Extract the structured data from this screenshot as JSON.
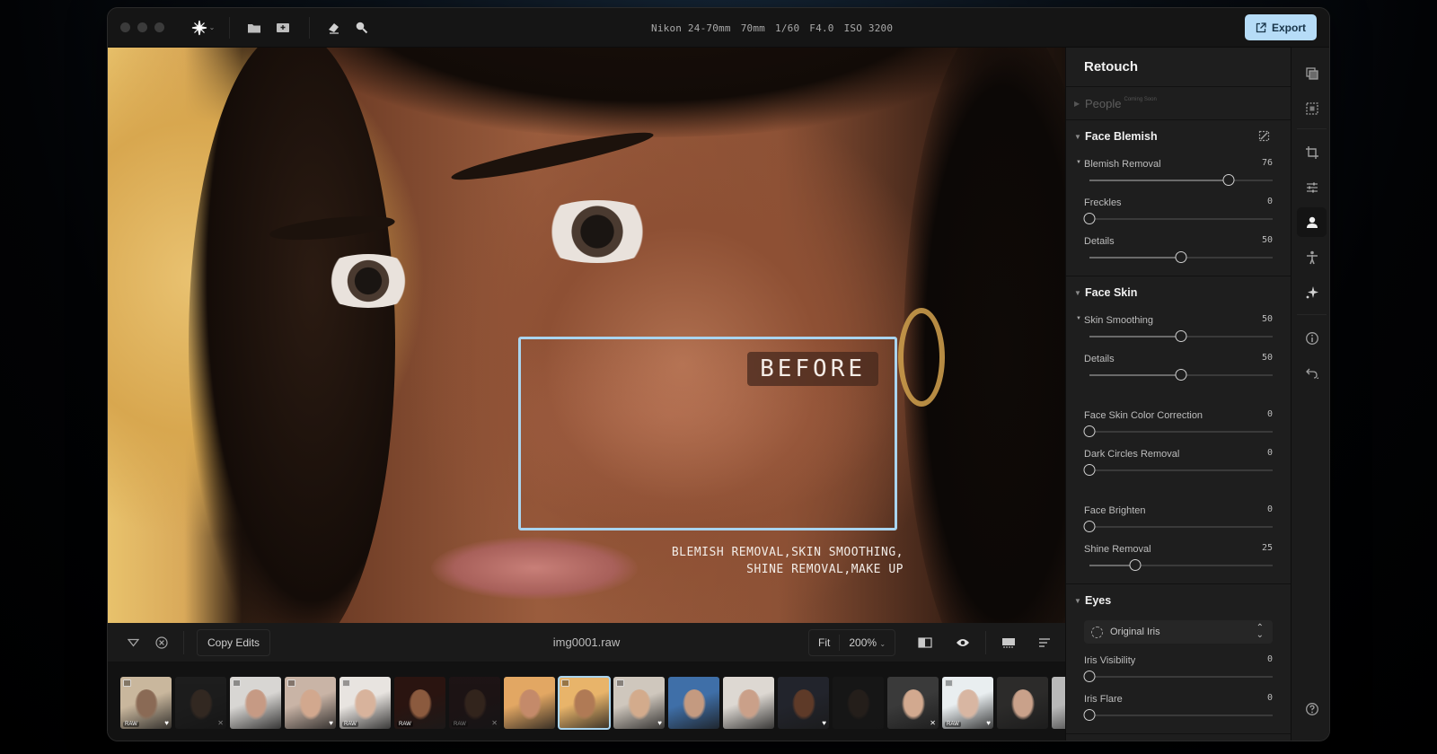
{
  "window": {
    "traffic_lights": [
      "close",
      "minimize",
      "maximize"
    ]
  },
  "toolbar": {
    "tools": [
      {
        "name": "ai-magic-icon",
        "has_dropdown": true
      },
      {
        "name": "folder-icon"
      },
      {
        "name": "import-icon"
      },
      {
        "name": "eraser-icon"
      },
      {
        "name": "search-icon"
      }
    ],
    "exif": [
      "Nikon 24-70mm",
      "70mm",
      "1/60",
      "F4.0",
      "ISO 3200"
    ],
    "export_label": "Export"
  },
  "canvas": {
    "before_label": "BEFORE",
    "caption_line1": "BLEMISH REMOVAL,SKIN SMOOTHING,",
    "caption_line2": "SHINE REMOVAL,MAKE UP"
  },
  "bottombar": {
    "copy_edits_label": "Copy Edits",
    "filename": "img0001.raw",
    "fit_label": "Fit",
    "zoom_label": "200%"
  },
  "filmstrip": [
    {
      "raw": true,
      "stack": true,
      "mark": "heart",
      "dim": false,
      "tone": [
        "#c9b79d",
        "#8a6a55"
      ]
    },
    {
      "raw": false,
      "stack": false,
      "mark": "x",
      "dim": true,
      "tone": [
        "#2a2a2a",
        "#5a4334"
      ]
    },
    {
      "raw": false,
      "stack": true,
      "mark": "",
      "dim": false,
      "tone": [
        "#d8d6d3",
        "#c69a84"
      ]
    },
    {
      "raw": false,
      "stack": true,
      "mark": "heart",
      "dim": false,
      "tone": [
        "#c9b4a6",
        "#d2a88e"
      ]
    },
    {
      "raw": true,
      "stack": true,
      "mark": "",
      "dim": false,
      "tone": [
        "#e8e4e0",
        "#d8b39c"
      ]
    },
    {
      "raw": true,
      "stack": false,
      "mark": "",
      "dim": false,
      "tone": [
        "#2a1410",
        "#8b5a3e"
      ]
    },
    {
      "raw": true,
      "stack": false,
      "mark": "x",
      "dim": true,
      "tone": [
        "#2a1518",
        "#5a3a2a"
      ]
    },
    {
      "raw": false,
      "stack": false,
      "mark": "",
      "dim": false,
      "tone": [
        "#e2a763",
        "#c48a6a"
      ]
    },
    {
      "raw": false,
      "stack": true,
      "mark": "",
      "dim": false,
      "selected": true,
      "tone": [
        "#e8b46a",
        "#b07a55"
      ]
    },
    {
      "raw": false,
      "stack": true,
      "mark": "heart",
      "dim": false,
      "tone": [
        "#cfc7bd",
        "#d3ab8c"
      ]
    },
    {
      "raw": false,
      "stack": false,
      "mark": "",
      "dim": false,
      "tone": [
        "#3f6fa8",
        "#c49a80"
      ]
    },
    {
      "raw": false,
      "stack": false,
      "mark": "",
      "dim": false,
      "tone": [
        "#ddd8d2",
        "#caa089"
      ]
    },
    {
      "raw": false,
      "stack": false,
      "mark": "heart",
      "dim": false,
      "tone": [
        "#22242c",
        "#5e3a28"
      ]
    },
    {
      "raw": false,
      "stack": false,
      "mark": "",
      "dim": true,
      "tone": [
        "#1c1c1c",
        "#3a2d25"
      ]
    },
    {
      "raw": false,
      "stack": false,
      "mark": "x",
      "dim": false,
      "tone": [
        "#3a3a3a",
        "#d2a98f"
      ]
    },
    {
      "raw": true,
      "stack": true,
      "mark": "heart",
      "dim": false,
      "tone": [
        "#e9eef0",
        "#d8b6a2"
      ]
    },
    {
      "raw": false,
      "stack": false,
      "mark": "",
      "dim": false,
      "tone": [
        "#2c2b2a",
        "#c9a18a"
      ]
    },
    {
      "raw": false,
      "stack": false,
      "mark": "",
      "dim": false,
      "tone": [
        "#b9b9b9",
        "#9a9a9a"
      ]
    }
  ],
  "panel": {
    "title": "Retouch",
    "people": {
      "label": "People",
      "badge": "Coming Soon"
    },
    "sections": [
      {
        "title": "Face Blemish",
        "sliders": [
          {
            "label": "Blemish Removal",
            "value": 76,
            "sub": true
          },
          {
            "label": "Freckles",
            "value": 0
          },
          {
            "label": "Details",
            "value": 50
          }
        ]
      },
      {
        "title": "Face Skin",
        "sliders": [
          {
            "label": "Skin Smoothing",
            "value": 50,
            "sub": true
          },
          {
            "label": "Details",
            "value": 50
          },
          {
            "label": "Face Skin Color Correction",
            "value": 0,
            "gap": true
          },
          {
            "label": "Dark Circles Removal",
            "value": 0
          },
          {
            "label": "Face Brighten",
            "value": 0,
            "gap": true
          },
          {
            "label": "Shine Removal",
            "value": 25
          }
        ]
      },
      {
        "title": "Eyes",
        "select": "Original Iris",
        "sliders": [
          {
            "label": "Iris Visibility",
            "value": 0
          },
          {
            "label": "Iris Flare",
            "value": 0
          }
        ]
      }
    ]
  },
  "rail": {
    "items": [
      "layers-icon",
      "mask-select-icon",
      "crop-icon",
      "adjustments-icon",
      "retouch-person-icon",
      "body-icon",
      "sparkle-icon",
      "info-icon",
      "undo-history-icon"
    ],
    "active": "retouch-person-icon",
    "help": "help-icon"
  },
  "colors": {
    "accent": "#b6dcf7",
    "before_frame": "#a9d4ef"
  }
}
